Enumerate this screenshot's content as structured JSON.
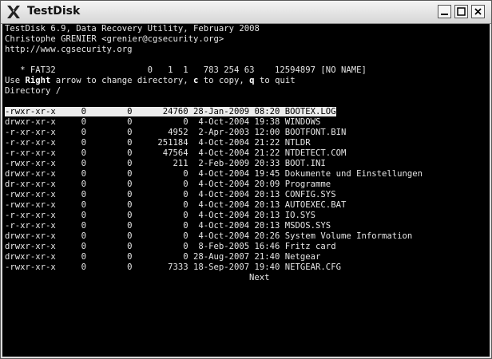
{
  "window": {
    "title": "TestDisk",
    "icons": {
      "app": "x-logo-icon",
      "minimize": "minimize-icon",
      "maximize": "maximize-icon",
      "close": "close-icon"
    }
  },
  "terminal": {
    "header_line1": "TestDisk 6.9, Data Recovery Utility, February 2008",
    "header_line2": "Christophe GRENIER <grenier@cgsecurity.org>",
    "header_line3": "http://www.cgsecurity.org",
    "partition_line": "   * FAT32                  0   1  1   783 254 63    12594897 [NO NAME]",
    "help": {
      "t1": "Use ",
      "k1": "Right",
      "t2": " arrow to change directory, ",
      "k2": "c",
      "t3": " to copy, ",
      "k3": "q",
      "t4": " to quit"
    },
    "directory_line": "Directory /",
    "next_label": "Next"
  },
  "listing": [
    {
      "perm": "-rwxr-xr-x",
      "uid": "0",
      "gid": "0",
      "size": "24760",
      "date": "28-Jan-2009",
      "time": "08:20",
      "name": "BOOTEX.LOG",
      "selected": true
    },
    {
      "perm": "drwxr-xr-x",
      "uid": "0",
      "gid": "0",
      "size": "0",
      "date": "4-Oct-2004",
      "time": "19:38",
      "name": "WINDOWS"
    },
    {
      "perm": "-r-xr-xr-x",
      "uid": "0",
      "gid": "0",
      "size": "4952",
      "date": "2-Apr-2003",
      "time": "12:00",
      "name": "BOOTFONT.BIN"
    },
    {
      "perm": "-r-xr-xr-x",
      "uid": "0",
      "gid": "0",
      "size": "251184",
      "date": "4-Oct-2004",
      "time": "21:22",
      "name": "NTLDR"
    },
    {
      "perm": "-r-xr-xr-x",
      "uid": "0",
      "gid": "0",
      "size": "47564",
      "date": "4-Oct-2004",
      "time": "21:22",
      "name": "NTDETECT.COM"
    },
    {
      "perm": "-rwxr-xr-x",
      "uid": "0",
      "gid": "0",
      "size": "211",
      "date": "2-Feb-2009",
      "time": "20:33",
      "name": "BOOT.INI"
    },
    {
      "perm": "drwxr-xr-x",
      "uid": "0",
      "gid": "0",
      "size": "0",
      "date": "4-Oct-2004",
      "time": "19:45",
      "name": "Dokumente und Einstellungen"
    },
    {
      "perm": "dr-xr-xr-x",
      "uid": "0",
      "gid": "0",
      "size": "0",
      "date": "4-Oct-2004",
      "time": "20:09",
      "name": "Programme"
    },
    {
      "perm": "-rwxr-xr-x",
      "uid": "0",
      "gid": "0",
      "size": "0",
      "date": "4-Oct-2004",
      "time": "20:13",
      "name": "CONFIG.SYS"
    },
    {
      "perm": "-rwxr-xr-x",
      "uid": "0",
      "gid": "0",
      "size": "0",
      "date": "4-Oct-2004",
      "time": "20:13",
      "name": "AUTOEXEC.BAT"
    },
    {
      "perm": "-r-xr-xr-x",
      "uid": "0",
      "gid": "0",
      "size": "0",
      "date": "4-Oct-2004",
      "time": "20:13",
      "name": "IO.SYS"
    },
    {
      "perm": "-r-xr-xr-x",
      "uid": "0",
      "gid": "0",
      "size": "0",
      "date": "4-Oct-2004",
      "time": "20:13",
      "name": "MSDOS.SYS"
    },
    {
      "perm": "drwxr-xr-x",
      "uid": "0",
      "gid": "0",
      "size": "0",
      "date": "4-Oct-2004",
      "time": "20:26",
      "name": "System Volume Information"
    },
    {
      "perm": "drwxr-xr-x",
      "uid": "0",
      "gid": "0",
      "size": "0",
      "date": "8-Feb-2005",
      "time": "16:46",
      "name": "Fritz card"
    },
    {
      "perm": "drwxr-xr-x",
      "uid": "0",
      "gid": "0",
      "size": "0",
      "date": "28-Aug-2007",
      "time": "21:40",
      "name": "Netgear"
    },
    {
      "perm": "-rwxr-xr-x",
      "uid": "0",
      "gid": "0",
      "size": "7333",
      "date": "18-Sep-2007",
      "time": "19:40",
      "name": "NETGEAR.CFG"
    }
  ],
  "colors": {
    "terminal_bg": "#000000",
    "terminal_fg": "#e6e6e6",
    "selection_bg": "#ececec"
  }
}
